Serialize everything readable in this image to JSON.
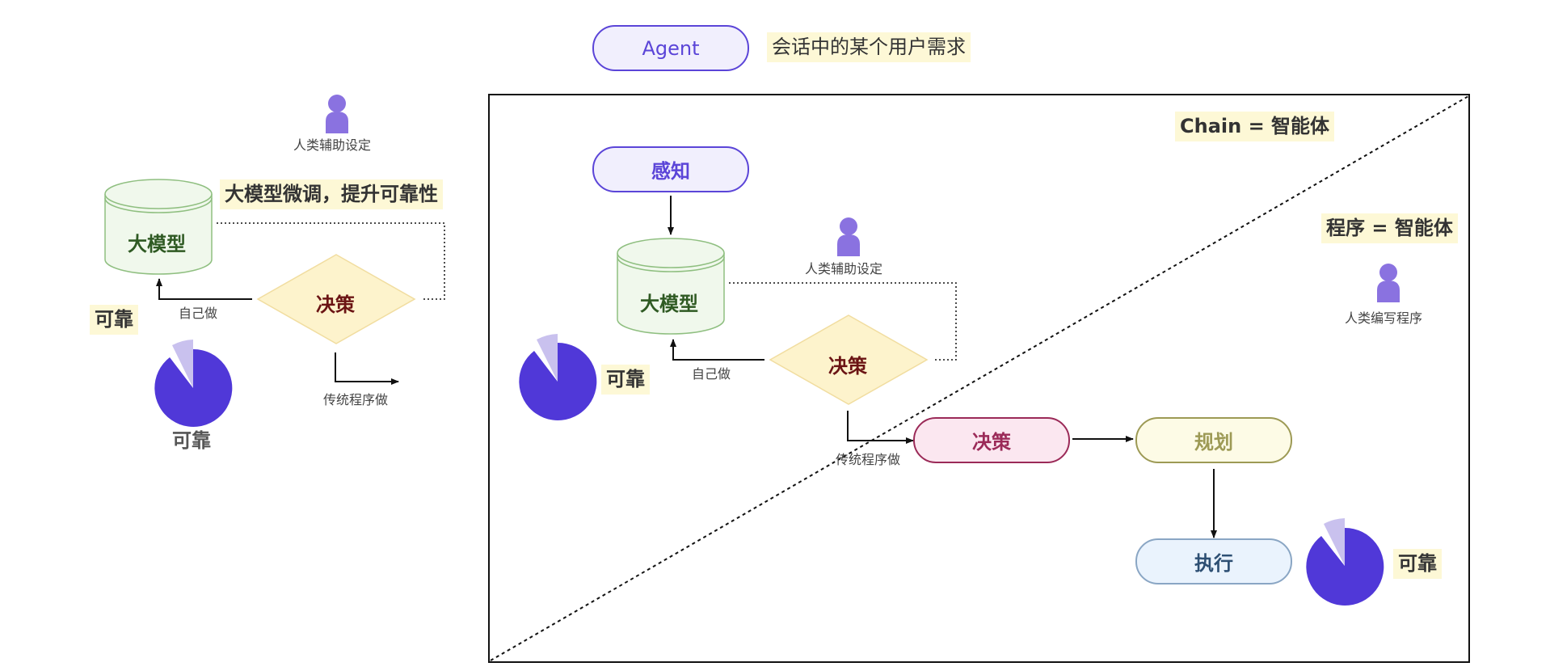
{
  "legend": {
    "agent_label": "Agent",
    "agent_desc": "会话中的某个用户需求"
  },
  "left": {
    "human_label": "人类辅助设定",
    "finetune_label": "大模型微调，提升可靠性",
    "llm_label": "大模型",
    "decision_label": "决策",
    "self_do_label": "自己做",
    "traditional_label": "传统程序做",
    "reliable_tag": "可靠",
    "pie_label": "可靠",
    "pie_value": 0.92
  },
  "right": {
    "chain_label": "Chain = 智能体",
    "program_label": "程序 = 智能体",
    "human_write_label": "人类编写程序",
    "perception_label": "感知",
    "llm_label": "大模型",
    "human_label": "人类辅助设定",
    "decision_diamond_label": "决策",
    "self_do_label": "自己做",
    "traditional_label": "传统程序做",
    "reliable_left_label": "可靠",
    "pie_left_value": 0.92,
    "decision_pill_label": "决策",
    "planning_label": "规划",
    "execute_label": "执行",
    "reliable_right_label": "可靠",
    "pie_right_value": 0.92
  },
  "colors": {
    "purple": "#5038d8",
    "purple_light": "#c9c1ee",
    "person": "#8a72e0",
    "tag_bg": "#fdf8d6"
  }
}
